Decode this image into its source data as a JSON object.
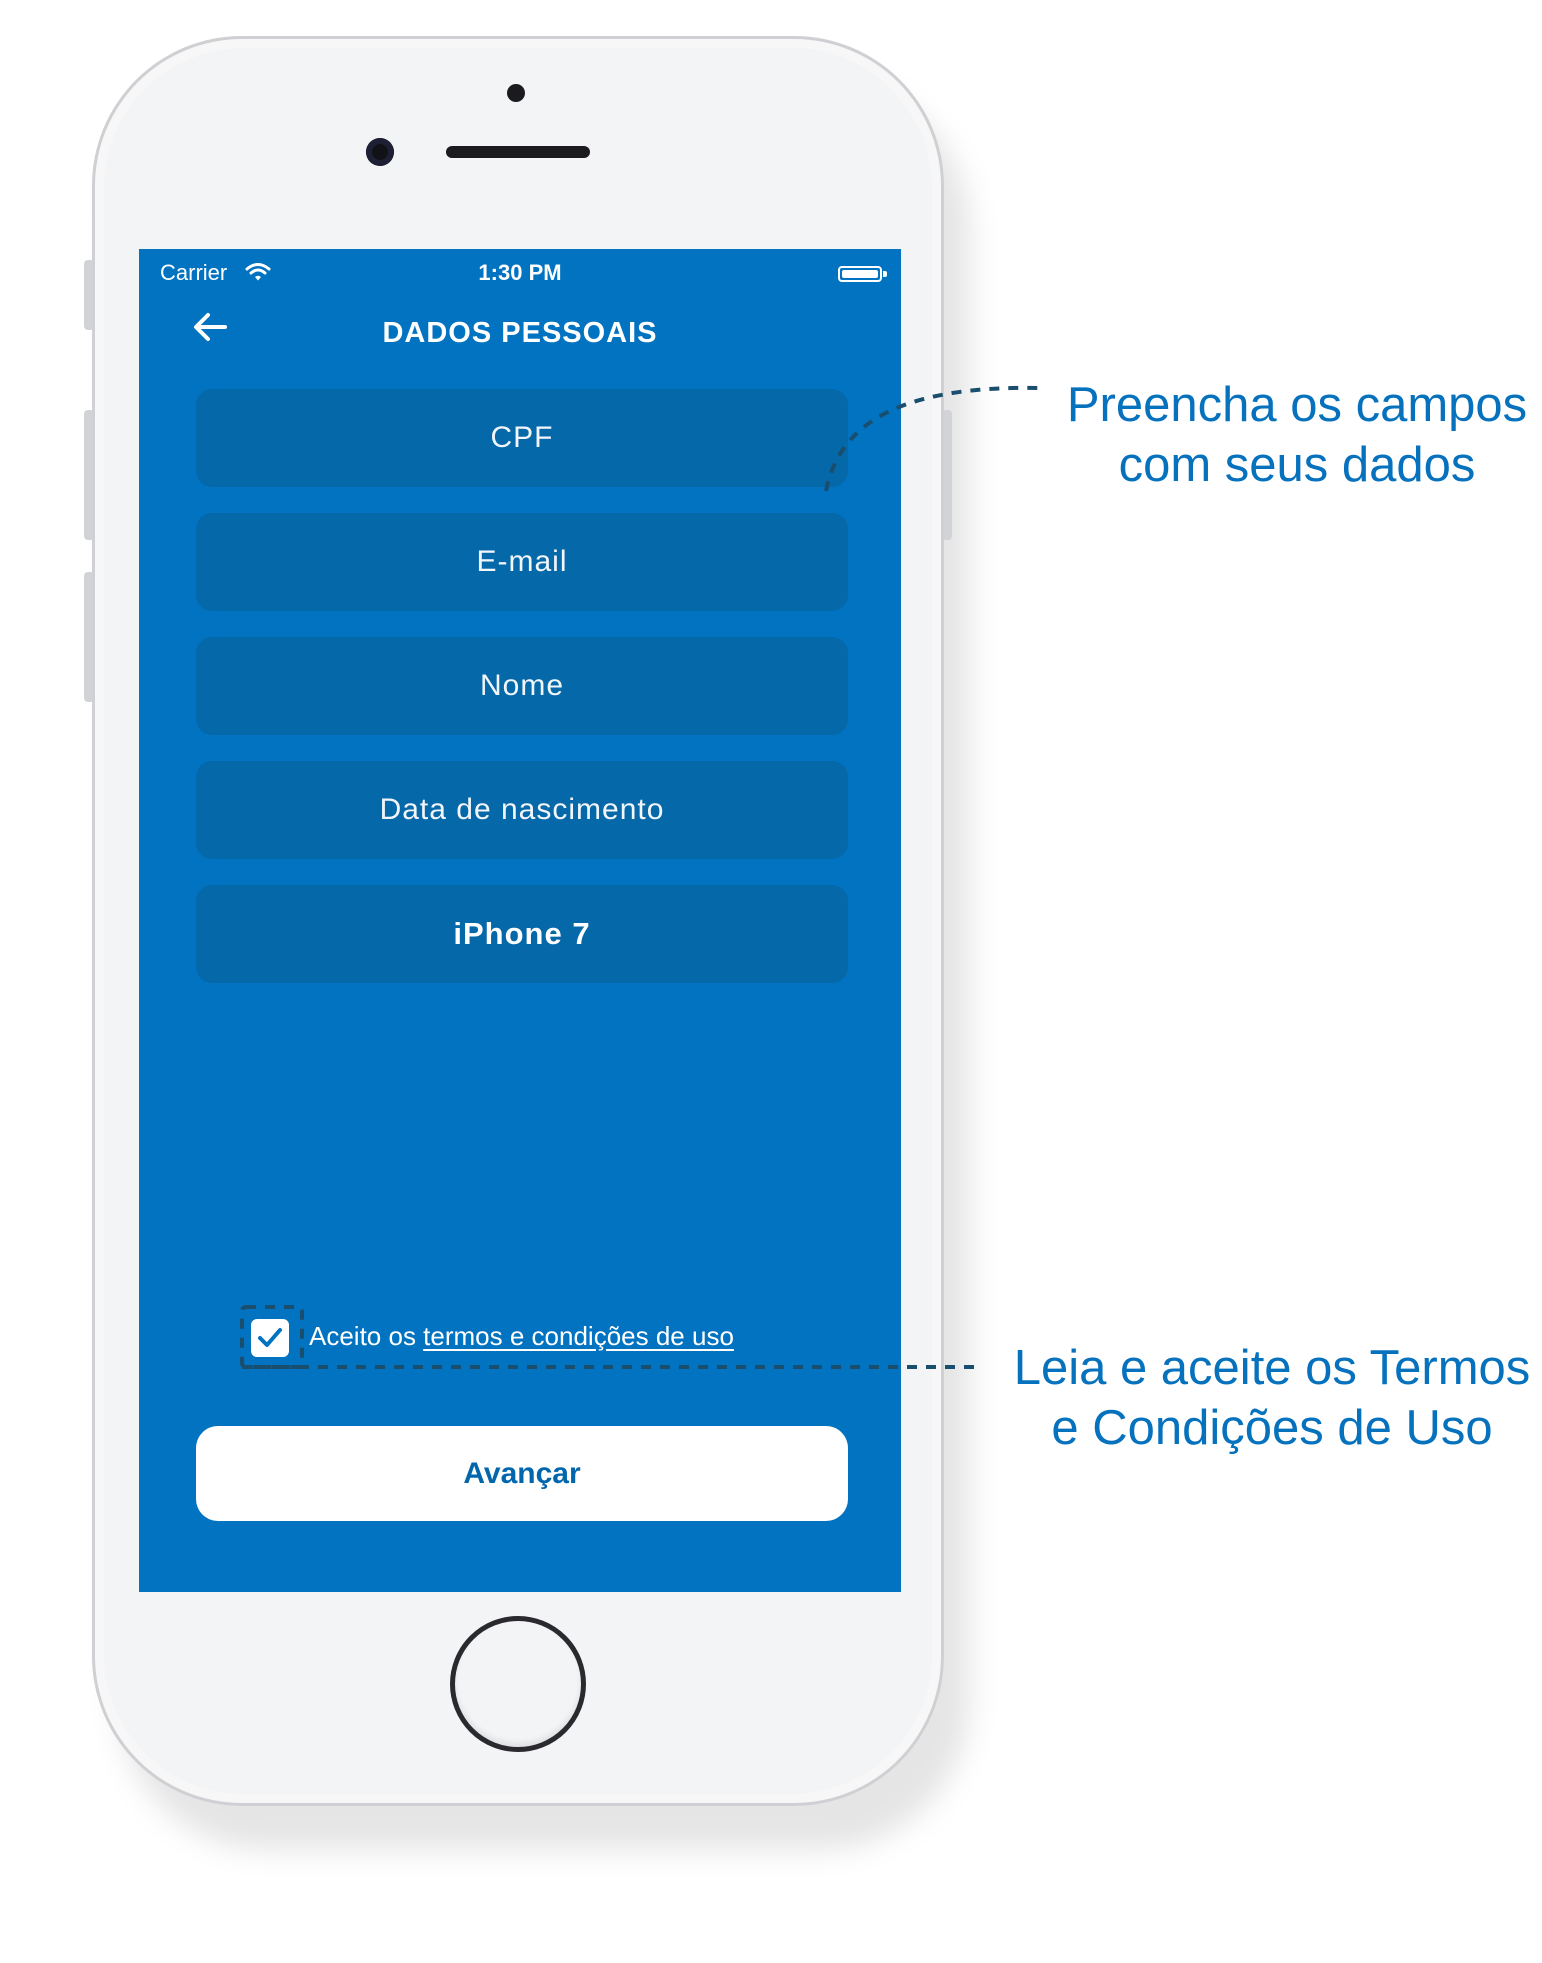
{
  "status_bar": {
    "carrier": "Carrier",
    "time": "1:30 PM"
  },
  "header": {
    "title": "DADOS PESSOAIS"
  },
  "form": {
    "cpf_placeholder": "CPF",
    "email_placeholder": "E-mail",
    "name_placeholder": "Nome",
    "birthdate_placeholder": "Data de nascimento",
    "device_value": "iPhone 7",
    "terms_checked": true,
    "terms_prefix": "Aceito os ",
    "terms_link": "termos e condições de uso",
    "next_label": "Avançar"
  },
  "annotations": {
    "fields_line1": "Preencha os campos",
    "fields_line2": "com seus dados",
    "terms_line1": "Leia e aceite os Termos",
    "terms_line2": "e Condições de Uso"
  },
  "colors": {
    "screen_background": "#0273c1",
    "field_background": "#0568a8",
    "annotation_text": "#0671bd",
    "button_text": "#0266ad"
  },
  "icons": [
    "back-arrow-icon",
    "wifi-icon",
    "battery-icon",
    "checkmark-icon"
  ]
}
